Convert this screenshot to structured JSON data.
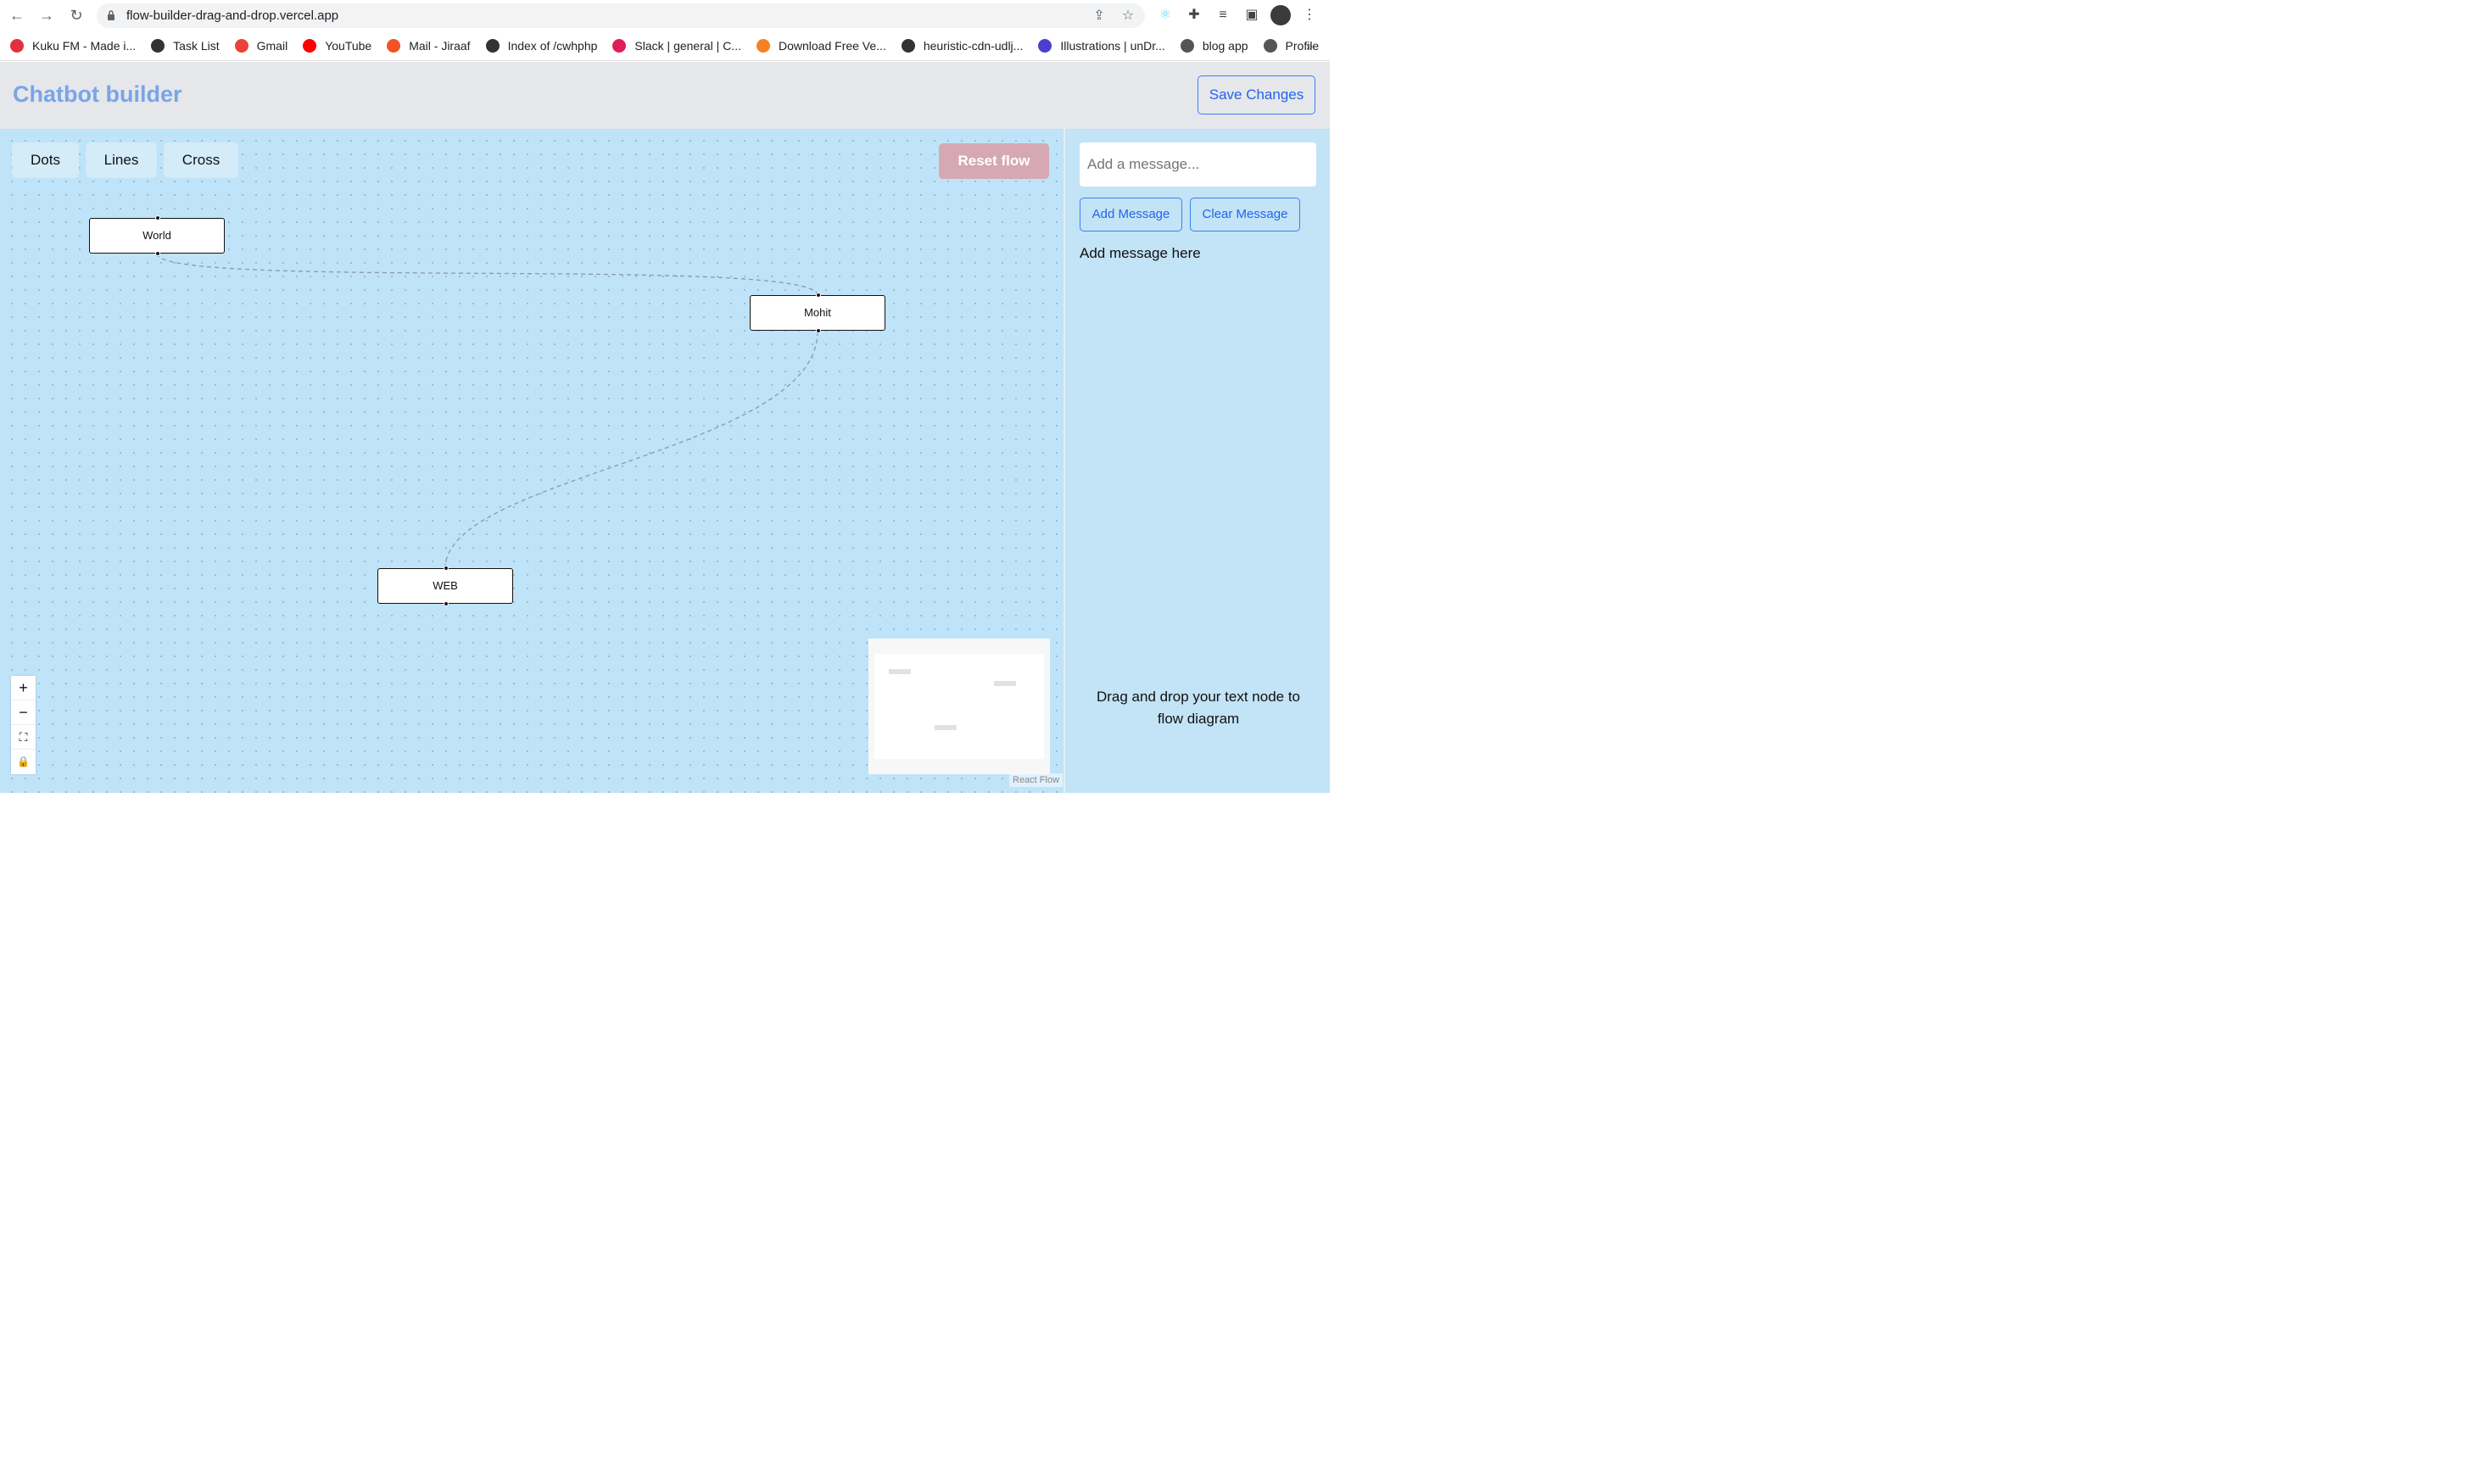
{
  "browser": {
    "url": "flow-builder-drag-and-drop.vercel.app",
    "bookmarks": [
      {
        "label": "Kuku FM - Made i...",
        "icon": "kukufm-icon",
        "color": "#e2313c"
      },
      {
        "label": "Task List",
        "icon": "checkmark-icon",
        "color": "#333333"
      },
      {
        "label": "Gmail",
        "icon": "gmail-icon",
        "color": "#ea4335"
      },
      {
        "label": "YouTube",
        "icon": "youtube-icon",
        "color": "#ff0000"
      },
      {
        "label": "Mail - Jiraaf",
        "icon": "microsoft-icon",
        "color": "#f35325"
      },
      {
        "label": "Index of /cwhphp",
        "icon": "globe-icon",
        "color": "#333333"
      },
      {
        "label": "Slack | general | C...",
        "icon": "slack-icon",
        "color": "#e01e5a"
      },
      {
        "label": "Download Free Ve...",
        "icon": "vecteezy-icon",
        "color": "#f58220"
      },
      {
        "label": "heuristic-cdn-udlj...",
        "icon": "globe-icon",
        "color": "#333333"
      },
      {
        "label": "Illustrations | unDr...",
        "icon": "undraw-icon",
        "color": "#4b3fd1"
      },
      {
        "label": "blog app",
        "icon": "codesandbox-icon",
        "color": "#555555"
      },
      {
        "label": "Profile",
        "icon": "codesandbox-icon",
        "color": "#555555"
      }
    ],
    "more": "»"
  },
  "header": {
    "title": "Chatbot builder",
    "save_label": "Save Changes"
  },
  "canvas": {
    "background_options": [
      "Dots",
      "Lines",
      "Cross"
    ],
    "reset_label": "Reset flow",
    "nodes": [
      {
        "id": "world",
        "label": "World"
      },
      {
        "id": "mohit",
        "label": "Mohit"
      },
      {
        "id": "web",
        "label": "WEB"
      }
    ],
    "edges": [
      {
        "source": "world",
        "target": "mohit"
      },
      {
        "source": "mohit",
        "target": "web"
      }
    ],
    "controls": [
      "+",
      "−",
      "⛶",
      "🔒"
    ],
    "attribution": "React Flow"
  },
  "panel": {
    "input_placeholder": "Add a message...",
    "add_label": "Add Message",
    "clear_label": "Clear Message",
    "message_text": "Add message here",
    "hint": "Drag and drop your text node to flow diagram"
  },
  "colors": {
    "accent": "#2563eb",
    "title": "#7aa5e6",
    "canvas_bg": "#bfe3f8",
    "reset_bg": "#d6a8b3"
  }
}
